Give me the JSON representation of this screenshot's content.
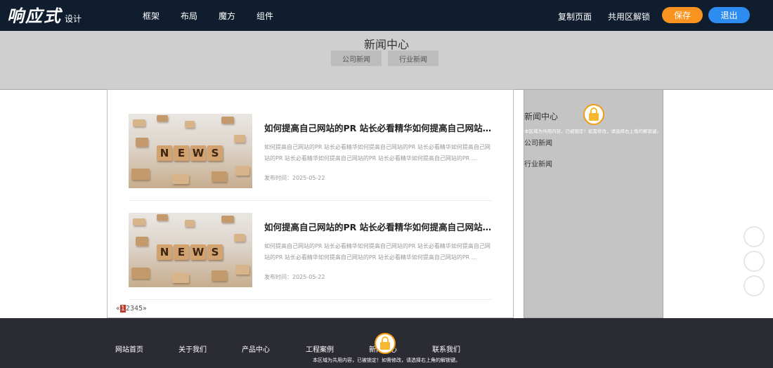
{
  "app": {
    "logo_text": "响应式",
    "logo_sub": "设计"
  },
  "topnav": [
    "框架",
    "布局",
    "魔方",
    "组件"
  ],
  "toolbar": {
    "copy_page": "复制页面",
    "unlock_shared": "共用区解锁",
    "save_label": "保存",
    "exit_label": "退出"
  },
  "banner": {
    "title": "新闻中心",
    "tabs": [
      "公司新闻",
      "行业新闻"
    ]
  },
  "news": [
    {
      "title": "如何提高自己网站的PR 站长必看精华如何提高自己网站的PR 站长必看精华",
      "desc": "如何提高自己网站的PR 站长必看精华如何提高自己网站的PR 站长必看精华如何提高自己网站的PR 站长必看精华如何提高自己网站的PR 站长必看精华如何提高自己网站的PR ...",
      "date": "发布时间：2025-05-22",
      "image_word": "NEWS"
    },
    {
      "title": "如何提高自己网站的PR 站长必看精华如何提高自己网站的PR 站长必看精华",
      "desc": "如何提高自己网站的PR 站长必看精华如何提高自己网站的PR 站长必看精华如何提高自己网站的PR 站长必看精华如何提高自己网站的PR 站长必看精华如何提高自己网站的PR ...",
      "date": "发布时间：2025-05-22",
      "image_word": "NEWS"
    }
  ],
  "pager": {
    "prev": "«",
    "pages": [
      "1",
      "2",
      "3",
      "4",
      "5"
    ],
    "current": "1",
    "next": "»"
  },
  "sidebar": {
    "title": "新闻中心",
    "items": [
      "公司新闻",
      "行业新闻"
    ],
    "lock_note": "本区域为共用内容，已被锁定！如需修改，请选择右上角的解锁键。"
  },
  "footer": {
    "nav": [
      "网站首页",
      "关于我们",
      "产品中心",
      "工程案例",
      "新闻中心",
      "联系我们"
    ],
    "lock_note": "本区域为共用内容，已被锁定！如需修改，请选择右上角的解锁键。"
  },
  "colors": {
    "topbar": "#0f1d2e",
    "save": "#f7931e",
    "exit": "#2d8cf0",
    "footer": "#2b2b33",
    "lock": "#f39c12"
  },
  "icons": {
    "lock": "lock-icon",
    "float": "circle-icon"
  }
}
